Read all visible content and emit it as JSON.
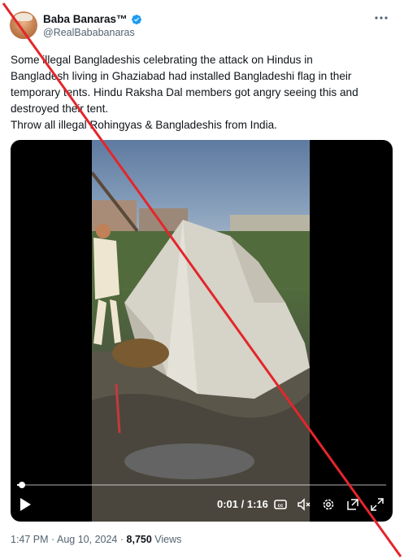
{
  "author": {
    "display_name": "Baba Banaras™",
    "handle": "@RealBababanaras"
  },
  "tweet": {
    "lines": [
      "Some illegal Bangladeshis celebrating the attack on Hindus in",
      "Bangladesh living in Ghaziabad had installed Bangladeshi flag in their",
      "temporary tents. Hindu Raksha Dal members got angry seeing this and",
      "destroyed their tent.",
      "Throw all illegal Rohingyas & Bangladeshis from India."
    ]
  },
  "video": {
    "elapsed": "0:01",
    "separator": "/",
    "duration": "1:16",
    "time_display": "0:01 / 1:16",
    "progress": 0.013
  },
  "meta": {
    "time": "1:47 PM",
    "date": "Aug 10, 2024",
    "dot": "·",
    "views_count": "8,750",
    "views_label": "Views"
  },
  "icons": {
    "verified": "verified-badge-icon",
    "more": "more-options-icon",
    "play": "play-icon",
    "captions": "closed-captions-icon",
    "volume": "volume-muted-icon",
    "settings": "settings-gear-icon",
    "popout": "pop-out-icon",
    "fullscreen": "fullscreen-icon"
  },
  "colors": {
    "verified_blue": "#1d9bf0",
    "secondary_text": "#536471",
    "overlay_red": "#e3262b"
  }
}
